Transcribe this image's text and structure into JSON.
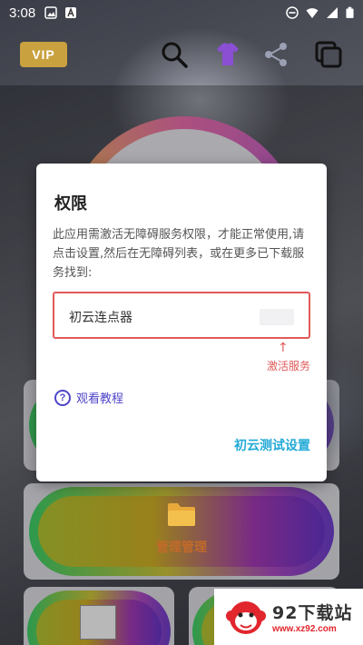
{
  "status_bar": {
    "time": "3:08"
  },
  "toolbar": {
    "vip_label": "VIP"
  },
  "dialog": {
    "title": "权限",
    "message": "此应用需激活无障碍服务权限，才能正常使用,请点击设置,然后在无障碍列表，或在更多已下载服务找到:",
    "service_name": "初云连点器",
    "arrow": "↑",
    "activate_hint": "激活服务",
    "tutorial_label": "观看教程",
    "help_glyph": "?",
    "test_settings_label": "初云测试设置"
  },
  "background": {
    "files_label": "管理管理"
  },
  "watermark": {
    "title": "92下载站",
    "url": "www.xz92.com"
  },
  "colors": {
    "accent_red": "#e05a5a",
    "link_blue": "#22a9d6",
    "tutorial_purple": "#4f45c9",
    "vip_gold": "#c9a13f"
  }
}
